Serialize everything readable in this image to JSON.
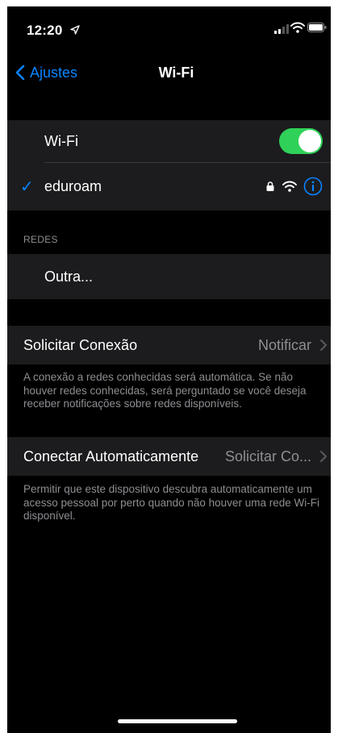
{
  "status_bar": {
    "time": "12:20",
    "location_icon": "location-arrow-icon",
    "signal_icon": "cellular-signal-icon",
    "wifi_icon": "wifi-icon",
    "battery_icon": "battery-icon"
  },
  "nav": {
    "back_label": "Ajustes",
    "title": "Wi-Fi"
  },
  "wifi": {
    "toggle_label": "Wi-Fi",
    "enabled": true,
    "connected_network": {
      "name": "eduroam",
      "secured": true,
      "checkmark": "✓"
    }
  },
  "networks": {
    "header": "REDES",
    "other_label": "Outra..."
  },
  "ask_to_join": {
    "label": "Solicitar Conexão",
    "value": "Notificar",
    "footer": "A conexão a redes conhecidas será automática. Se não houver redes conhecidas, será perguntado se você deseja receber notificações sobre redes disponíveis."
  },
  "auto_join": {
    "label": "Conectar Automaticamente",
    "value": "Solicitar Co...",
    "footer": "Permitir que este dispositivo descubra automaticamente um acesso pessoal por perto quando não houver uma rede Wi-Fi disponível."
  },
  "colors": {
    "accent": "#0a84ff",
    "toggle_on": "#30d158",
    "cell_bg": "#1c1c1e",
    "secondary_text": "#8e8e93"
  }
}
